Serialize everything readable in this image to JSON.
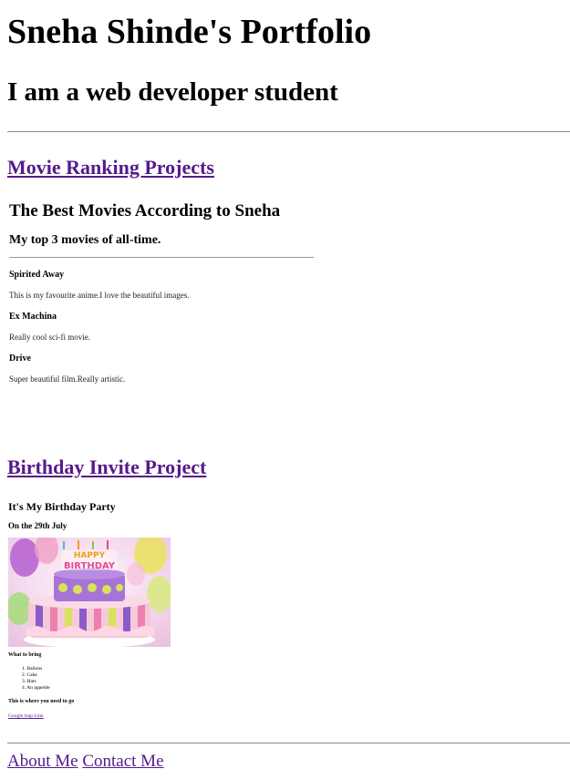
{
  "header": {
    "title": "Sneha Shinde's Portfolio",
    "subtitle": "I am a web developer student"
  },
  "projects": {
    "movies_link": "Movie Ranking Projects",
    "birthday_link": "Birthday Invite Project"
  },
  "movies": {
    "title": "The Best Movies According to Sneha",
    "subtitle": "My top 3 movies of all-time.",
    "items": [
      {
        "name": "Spirited Away",
        "desc": "This is my favourite anime.I love the beautiful images."
      },
      {
        "name": "Ex Machina",
        "desc": "Really cool sci-fi movie."
      },
      {
        "name": "Drive",
        "desc": "Super beautiful film.Really artistic."
      }
    ]
  },
  "birthday": {
    "title": "It's My Birthday Party",
    "date": "On the 29th July",
    "image_caption": "HAPPY BIRTHDAY",
    "bring_heading": "What to bring",
    "bring_items": [
      "Ballons",
      "Cake",
      "Hats",
      "An appetite"
    ],
    "location_heading": "This is where you need to go",
    "map_link": "Google map Link"
  },
  "footer": {
    "about": "About Me",
    "contact": "Contact Me"
  },
  "colors": {
    "link": "#551a8b",
    "rule": "#888888"
  }
}
